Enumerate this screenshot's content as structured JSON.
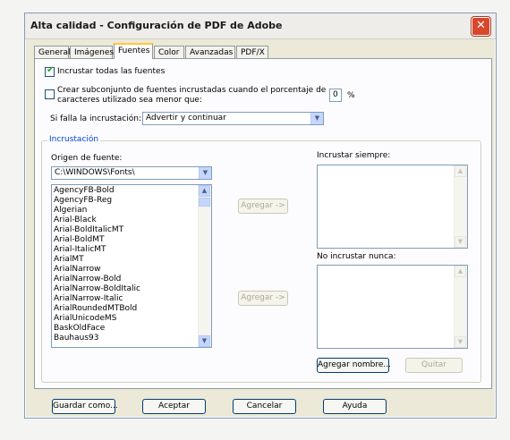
{
  "window": {
    "title": "Alta calidad - Configuración de PDF de Adobe",
    "close_glyph": "✕"
  },
  "tabs": [
    {
      "label": "General"
    },
    {
      "label": "Imágenes"
    },
    {
      "label": "Fuentes",
      "active": true
    },
    {
      "label": "Color"
    },
    {
      "label": "Avanzadas"
    },
    {
      "label": "PDF/X"
    }
  ],
  "fonts": {
    "embed_all_label": "Incrustar todas las fuentes",
    "embed_all_checked": true,
    "subset_line1": "Crear subconjunto de fuentes incrustadas cuando el porcentaje de",
    "subset_line2": "caracteres utilizado sea menor que:",
    "subset_checked": false,
    "subset_value": "0",
    "percent_sign": "%",
    "fail_label": "Si falla la incrustación:",
    "fail_value": "Advertir y continuar"
  },
  "embedding": {
    "group_title": "Incrustación",
    "source_label": "Origen de fuente:",
    "source_value": "C:\\WINDOWS\\Fonts\\",
    "font_list": [
      "AgencyFB-Bold",
      "AgencyFB-Reg",
      "Algerian",
      "Arial-Black",
      "Arial-BoldItalicMT",
      "Arial-BoldMT",
      "Arial-ItalicMT",
      "ArialMT",
      "ArialNarrow",
      "ArialNarrow-Bold",
      "ArialNarrow-BoldItalic",
      "ArialNarrow-Italic",
      "ArialRoundedMTBold",
      "ArialUnicodeMS",
      "BaskOldFace",
      "Bauhaus93"
    ],
    "add_always_label": "Agregar ->",
    "add_never_label": "Agregar ->",
    "always_label": "Incrustar siempre:",
    "never_label": "No incrustar nunca:",
    "add_name_label": "Agregar nombre...",
    "remove_label": "Quitar"
  },
  "footer": {
    "save_as": "Guardar como...",
    "ok": "Aceptar",
    "cancel": "Cancelar",
    "help": "Ayuda"
  },
  "icons": {
    "dropdown": "chevron-down-icon",
    "scroll_up": "scroll-up-icon",
    "scroll_down": "scroll-down-icon",
    "close": "close-icon",
    "check": "checkmark-icon"
  },
  "colors": {
    "group_title": "#0046d5",
    "close_button": "#d9462b",
    "active_tab_accent": "#ffc83c"
  }
}
